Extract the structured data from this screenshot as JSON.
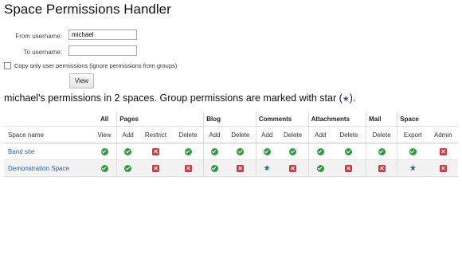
{
  "title": "Space Permissions Handler",
  "form": {
    "from_label": "From username:",
    "from_value": "michael",
    "to_label": "To username:",
    "to_value": "",
    "copy_only_label": "Copy only user permissions (ignore permissions from groups)",
    "view_button": "View"
  },
  "summary": {
    "text": "michael's permissions in 2 spaces. Group permissions are marked with star (",
    "star": "★",
    "end": ")."
  },
  "table": {
    "group_headers": [
      {
        "label": "All"
      },
      {
        "label": "Pages"
      },
      {
        "label": "Blog"
      },
      {
        "label": "Comments"
      },
      {
        "label": "Attachments"
      },
      {
        "label": "Mail"
      },
      {
        "label": "Space"
      }
    ],
    "space_name_header": "Space name",
    "columns": [
      "View",
      "Add",
      "Restrict",
      "Delete",
      "Add",
      "Delete",
      "Add",
      "Delete",
      "Add",
      "Delete",
      "Delete",
      "Export",
      "Admin"
    ],
    "rows": [
      {
        "name": "Band site",
        "cells": [
          "yes",
          "yes",
          "no",
          "yes",
          "yes",
          "yes",
          "yes",
          "yes",
          "yes",
          "yes",
          "yes",
          "yes",
          "no"
        ]
      },
      {
        "name": "Demonstration Space",
        "cells": [
          "yes",
          "yes",
          "no",
          "no",
          "yes",
          "no",
          "star",
          "no",
          "yes",
          "no",
          "no",
          "star",
          "no"
        ]
      }
    ]
  },
  "colors": {
    "granted": "#2e9c3d",
    "denied": "#d4363f",
    "group": "#1f5fa6",
    "link": "#2a63b1"
  },
  "icons": {
    "yes": "check-circle-icon",
    "no": "x-square-icon",
    "star": "star-icon"
  }
}
